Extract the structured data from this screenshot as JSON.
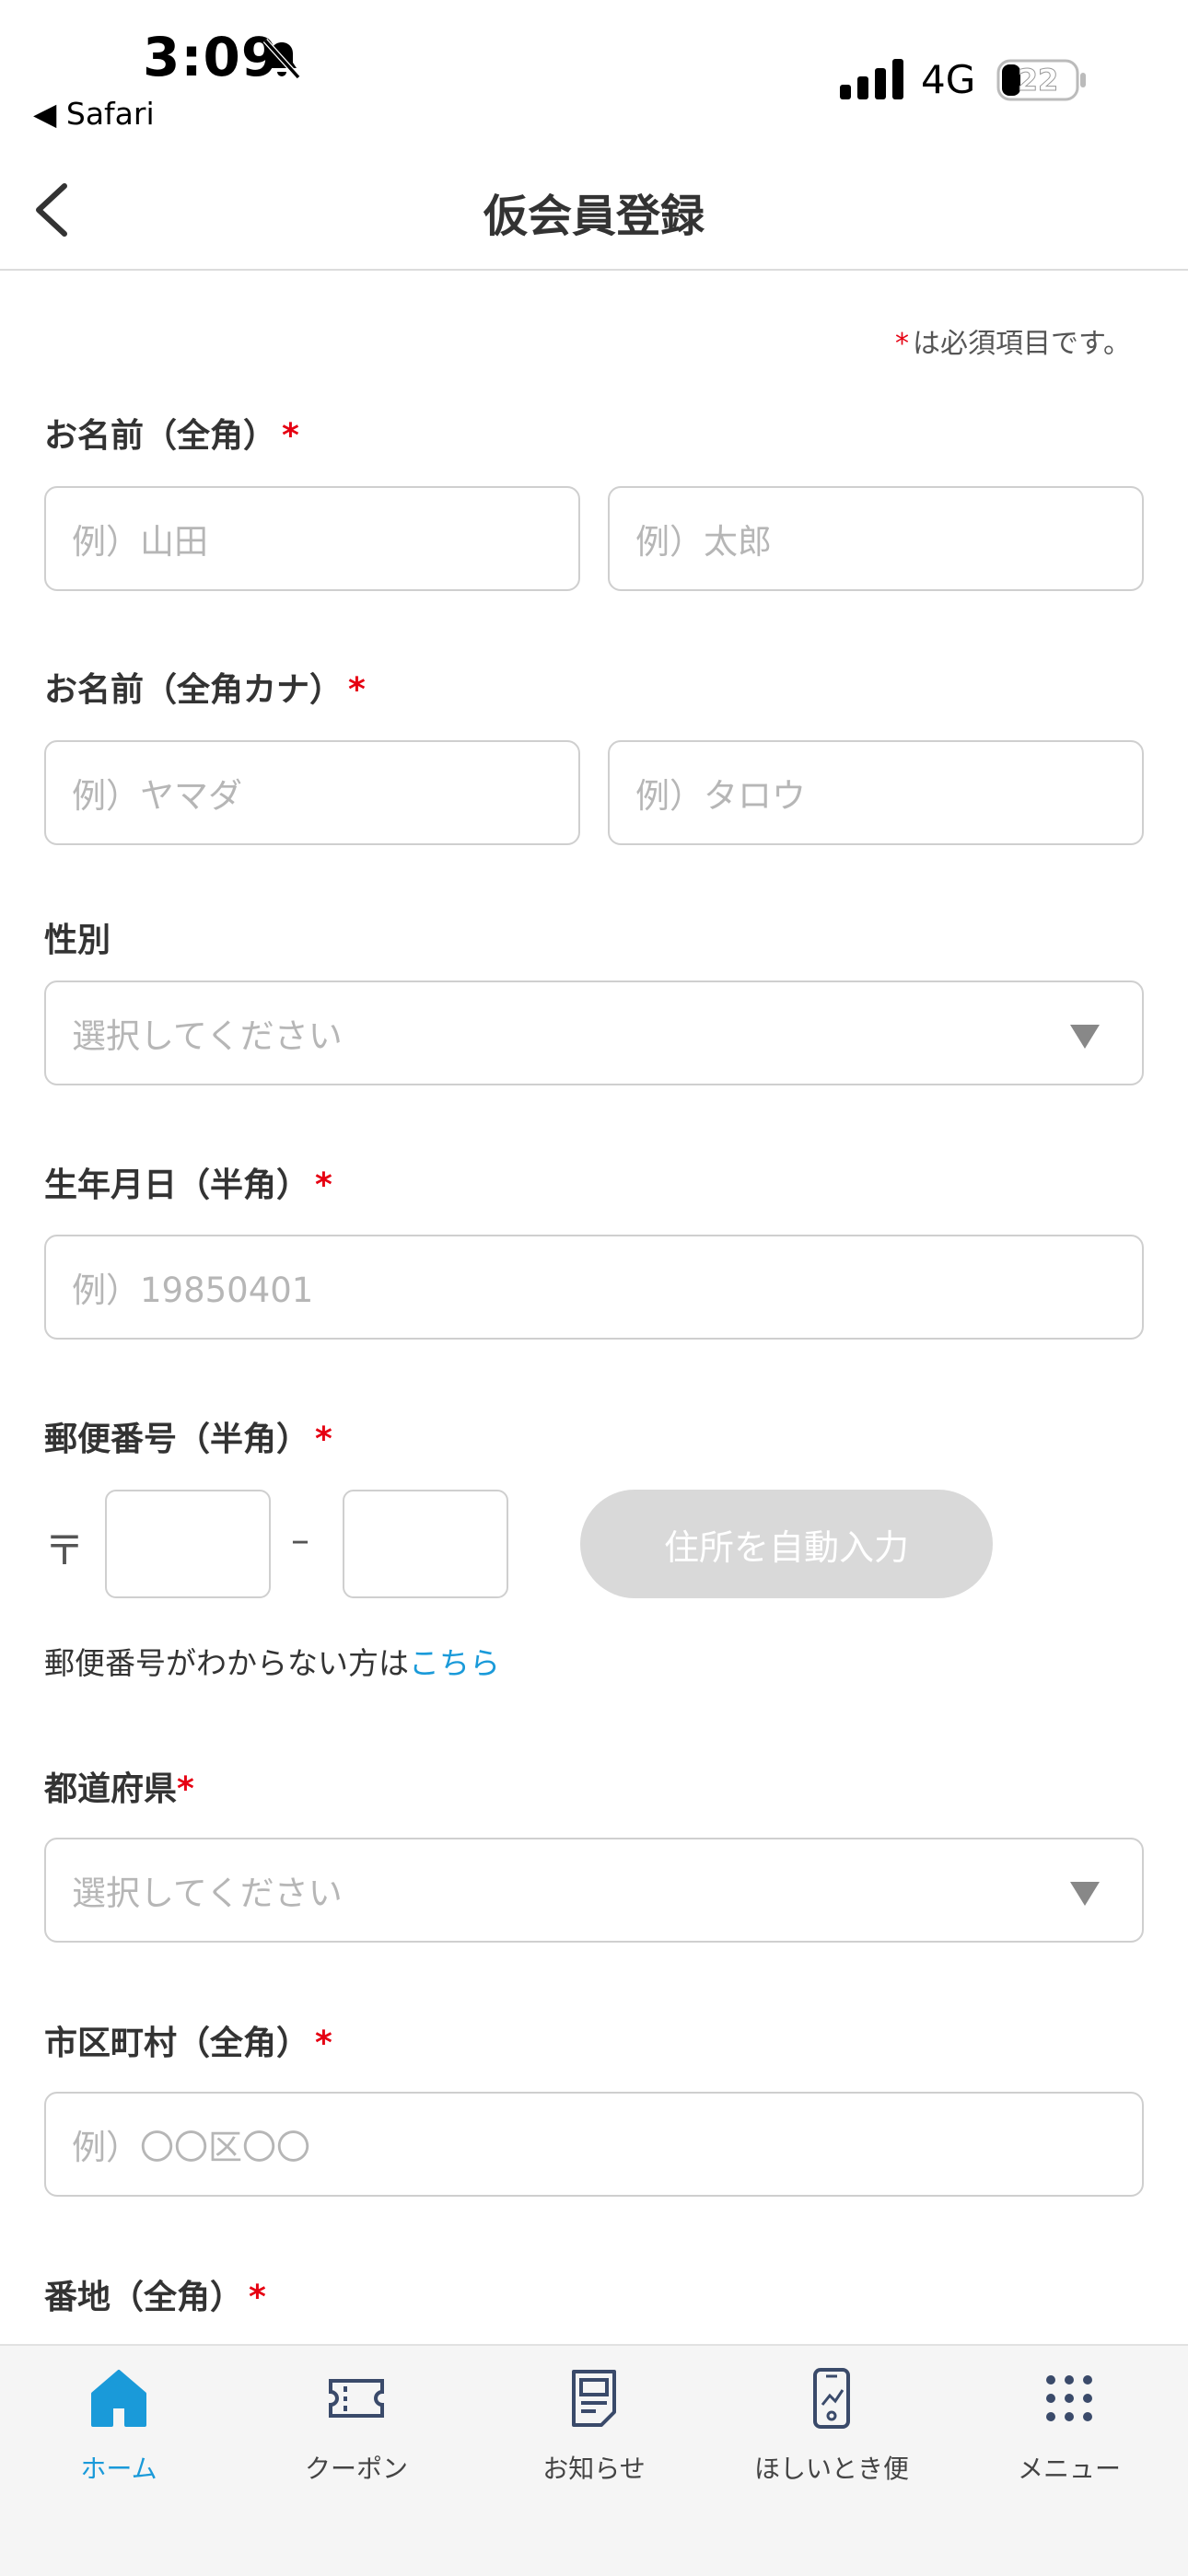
{
  "status_bar": {
    "time": "3:09",
    "back_app": "◀ Safari",
    "network": "4G",
    "battery": "22"
  },
  "header": {
    "title": "仮会員登録"
  },
  "required_note": "は必須項目です。",
  "form": {
    "name": {
      "label": "お名前（全角）",
      "last_placeholder": "例）山田",
      "first_placeholder": "例）太郎"
    },
    "name_kana": {
      "label": "お名前（全角カナ）",
      "last_placeholder": "例）ヤマダ",
      "first_placeholder": "例）タロウ"
    },
    "gender": {
      "label": "性別",
      "selected": "選択してください"
    },
    "birthdate": {
      "label": "生年月日（半角）",
      "placeholder": "例）19850401"
    },
    "postal": {
      "label": "郵便番号（半角）",
      "mark": "〒",
      "dash": "–",
      "auto_button": "住所を自動入力",
      "help_prefix": "郵便番号がわからない方は",
      "help_link": "こちら"
    },
    "prefecture": {
      "label": "都道府県",
      "selected": "選択してください"
    },
    "city": {
      "label": "市区町村（全角）",
      "placeholder": "例）〇〇区〇〇"
    },
    "address": {
      "label": "番地（全角）"
    },
    "required_star": "*"
  },
  "tabs": [
    {
      "label": "ホーム",
      "icon": "home-icon",
      "active": true
    },
    {
      "label": "クーポン",
      "icon": "ticket-icon",
      "active": false
    },
    {
      "label": "お知らせ",
      "icon": "notice-icon",
      "active": false
    },
    {
      "label": "ほしいとき便",
      "icon": "phone-delivery-icon",
      "active": false
    },
    {
      "label": "メニュー",
      "icon": "grid-menu-icon",
      "active": false
    }
  ],
  "colors": {
    "accent": "#1a9ad9",
    "required": "#e60012",
    "disabled_button": "#d9d9d9"
  }
}
